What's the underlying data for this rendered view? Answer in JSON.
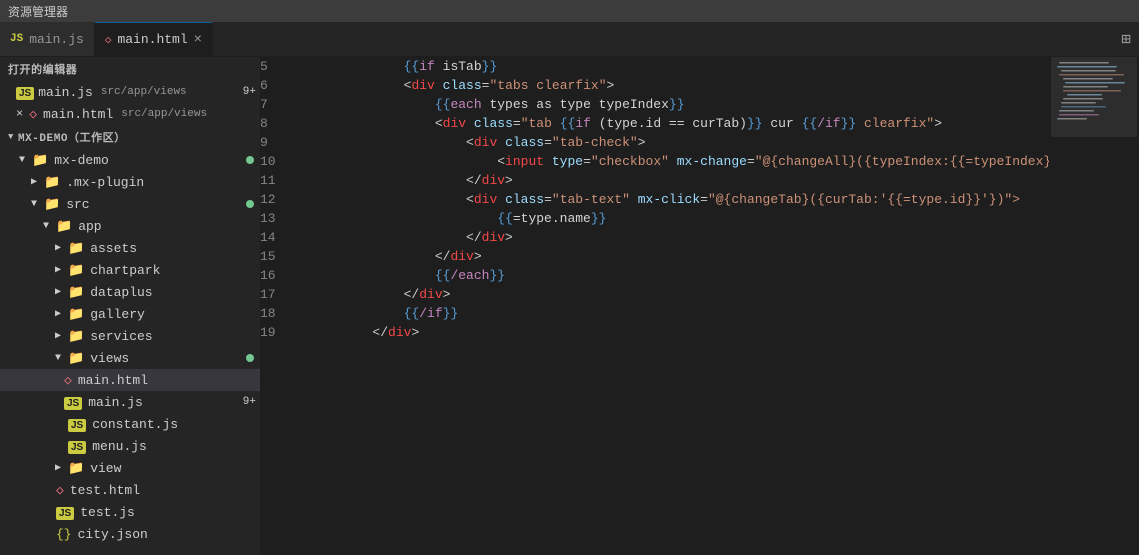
{
  "titleBar": {
    "label": "资源管理器"
  },
  "tabs": [
    {
      "id": "main-js",
      "type": "js",
      "label": "main.js",
      "path": "src/app/views",
      "badge": "9+",
      "active": false,
      "modified": false
    },
    {
      "id": "main-html",
      "type": "html",
      "label": "main.html",
      "path": "src/app/views",
      "active": true,
      "modified": true
    }
  ],
  "sidebar": {
    "openedEditors": "打开的编辑器",
    "workspaceName": "MX-DEMO（工作区）",
    "openedFiles": [
      {
        "type": "js",
        "name": "main.js",
        "path": "src/app/views",
        "badge": "9+"
      },
      {
        "type": "html",
        "name": "main.html",
        "path": "src/app/views",
        "modified": true
      }
    ],
    "tree": [
      {
        "id": "mx-demo",
        "level": 0,
        "type": "folder-open",
        "label": "mx-demo",
        "hasDot": true
      },
      {
        "id": "mx-plugin",
        "level": 1,
        "type": "folder-closed",
        "label": ".mx-plugin"
      },
      {
        "id": "src",
        "level": 1,
        "type": "folder-open",
        "label": "src",
        "hasDot": true
      },
      {
        "id": "app",
        "level": 2,
        "type": "folder-open",
        "label": "app"
      },
      {
        "id": "assets",
        "level": 3,
        "type": "folder-closed",
        "label": "assets"
      },
      {
        "id": "chartpark",
        "level": 3,
        "type": "folder-closed",
        "label": "chartpark"
      },
      {
        "id": "dataplus",
        "level": 3,
        "type": "folder-closed",
        "label": "dataplus"
      },
      {
        "id": "gallery",
        "level": 3,
        "type": "folder-closed",
        "label": "gallery"
      },
      {
        "id": "services",
        "level": 3,
        "type": "folder-closed",
        "label": "services"
      },
      {
        "id": "views",
        "level": 3,
        "type": "folder-open",
        "label": "views",
        "hasDot": true
      },
      {
        "id": "main-html-tree",
        "level": 4,
        "type": "html",
        "label": "main.html",
        "active": true
      },
      {
        "id": "main-js-tree",
        "level": 4,
        "type": "js",
        "label": "main.js",
        "badge": "9+"
      },
      {
        "id": "constant-js",
        "level": 3,
        "type": "js",
        "label": "constant.js"
      },
      {
        "id": "menu-js",
        "level": 3,
        "type": "js",
        "label": "menu.js"
      },
      {
        "id": "view",
        "level": 3,
        "type": "folder-closed",
        "label": "view"
      },
      {
        "id": "test-html",
        "level": 2,
        "type": "html",
        "label": "test.html"
      },
      {
        "id": "test-js",
        "level": 2,
        "type": "js",
        "label": "test.js"
      },
      {
        "id": "city-json",
        "level": 2,
        "type": "json",
        "label": "city.json"
      }
    ]
  },
  "editor": {
    "lines": [
      {
        "num": 5,
        "tokens": [
          {
            "t": "t-plain",
            "v": "            "
          },
          {
            "t": "t-tmpl-brace",
            "v": "{{"
          },
          {
            "t": "t-kw",
            "v": "if"
          },
          {
            "t": "t-plain",
            "v": " isTab"
          },
          {
            "t": "t-tmpl-brace",
            "v": "}}"
          }
        ]
      },
      {
        "num": 6,
        "tokens": [
          {
            "t": "t-plain",
            "v": "            "
          },
          {
            "t": "t-punct",
            "v": "<"
          },
          {
            "t": "t-tag",
            "v": "div"
          },
          {
            "t": "t-plain",
            "v": " "
          },
          {
            "t": "t-attr",
            "v": "class"
          },
          {
            "t": "t-punct",
            "v": "="
          },
          {
            "t": "t-str",
            "v": "\"tabs clearfix\""
          },
          {
            "t": "t-punct",
            "v": ">"
          }
        ]
      },
      {
        "num": 7,
        "tokens": [
          {
            "t": "t-plain",
            "v": "                "
          },
          {
            "t": "t-tmpl-brace",
            "v": "{{"
          },
          {
            "t": "t-kw",
            "v": "each"
          },
          {
            "t": "t-plain",
            "v": " types as type typeIndex"
          },
          {
            "t": "t-tmpl-brace",
            "v": "}}"
          }
        ]
      },
      {
        "num": 8,
        "tokens": [
          {
            "t": "t-plain",
            "v": "                "
          },
          {
            "t": "t-punct",
            "v": "<"
          },
          {
            "t": "t-tag",
            "v": "div"
          },
          {
            "t": "t-plain",
            "v": " "
          },
          {
            "t": "t-attr",
            "v": "class"
          },
          {
            "t": "t-punct",
            "v": "="
          },
          {
            "t": "t-str",
            "v": "\"tab "
          },
          {
            "t": "t-tmpl-brace",
            "v": "{{"
          },
          {
            "t": "t-kw",
            "v": "if"
          },
          {
            "t": "t-plain",
            "v": " (type.id == curTab)"
          },
          {
            "t": "t-tmpl-brace",
            "v": "}}"
          },
          {
            "t": "t-plain",
            "v": " cur "
          },
          {
            "t": "t-tmpl-brace",
            "v": "{{"
          },
          {
            "t": "t-kw",
            "v": "/if"
          },
          {
            "t": "t-tmpl-brace",
            "v": "}}"
          },
          {
            "t": "t-str",
            "v": " clearfix\""
          },
          {
            "t": "t-punct",
            "v": ">"
          }
        ]
      },
      {
        "num": 9,
        "tokens": [
          {
            "t": "t-plain",
            "v": "                    "
          },
          {
            "t": "t-punct",
            "v": "<"
          },
          {
            "t": "t-tag",
            "v": "div"
          },
          {
            "t": "t-plain",
            "v": " "
          },
          {
            "t": "t-attr",
            "v": "class"
          },
          {
            "t": "t-punct",
            "v": "="
          },
          {
            "t": "t-str",
            "v": "\"tab-check\""
          },
          {
            "t": "t-punct",
            "v": ">"
          }
        ]
      },
      {
        "num": 10,
        "tokens": [
          {
            "t": "t-plain",
            "v": "                        "
          },
          {
            "t": "t-punct",
            "v": "<"
          },
          {
            "t": "t-tag",
            "v": "input"
          },
          {
            "t": "t-plain",
            "v": " "
          },
          {
            "t": "t-attr",
            "v": "type"
          },
          {
            "t": "t-punct",
            "v": "="
          },
          {
            "t": "t-str",
            "v": "\"checkbox\""
          },
          {
            "t": "t-plain",
            "v": " "
          },
          {
            "t": "t-attr",
            "v": "mx-change"
          },
          {
            "t": "t-punct",
            "v": "="
          },
          {
            "t": "t-str",
            "v": "\"@{changeAll}({typeIndex:{{=typeIndex}}})\"}"
          },
          {
            "t": "t-plain",
            "v": " />"
          }
        ]
      },
      {
        "num": 11,
        "tokens": [
          {
            "t": "t-plain",
            "v": "                    "
          },
          {
            "t": "t-punct",
            "v": "</"
          },
          {
            "t": "t-tag",
            "v": "div"
          },
          {
            "t": "t-punct",
            "v": ">"
          }
        ]
      },
      {
        "num": 12,
        "tokens": [
          {
            "t": "t-plain",
            "v": "                    "
          },
          {
            "t": "t-punct",
            "v": "<"
          },
          {
            "t": "t-tag",
            "v": "div"
          },
          {
            "t": "t-plain",
            "v": " "
          },
          {
            "t": "t-attr",
            "v": "class"
          },
          {
            "t": "t-punct",
            "v": "="
          },
          {
            "t": "t-str",
            "v": "\"tab-text\""
          },
          {
            "t": "t-plain",
            "v": " "
          },
          {
            "t": "t-attr",
            "v": "mx-click"
          },
          {
            "t": "t-punct",
            "v": "="
          },
          {
            "t": "t-str",
            "v": "\"@{changeTab}({curTab:'{{=type.id}}'})\">"
          }
        ]
      },
      {
        "num": 13,
        "tokens": [
          {
            "t": "t-plain",
            "v": "                        "
          },
          {
            "t": "t-tmpl-brace",
            "v": "{{"
          },
          {
            "t": "t-plain",
            "v": "=type.name"
          },
          {
            "t": "t-tmpl-brace",
            "v": "}}"
          }
        ]
      },
      {
        "num": 14,
        "tokens": [
          {
            "t": "t-plain",
            "v": "                    "
          },
          {
            "t": "t-punct",
            "v": "</"
          },
          {
            "t": "t-tag",
            "v": "div"
          },
          {
            "t": "t-punct",
            "v": ">"
          }
        ]
      },
      {
        "num": 15,
        "tokens": [
          {
            "t": "t-plain",
            "v": "                "
          },
          {
            "t": "t-punct",
            "v": "</"
          },
          {
            "t": "t-tag",
            "v": "div"
          },
          {
            "t": "t-punct",
            "v": ">"
          }
        ]
      },
      {
        "num": 16,
        "tokens": [
          {
            "t": "t-plain",
            "v": "                "
          },
          {
            "t": "t-tmpl-brace",
            "v": "{{"
          },
          {
            "t": "t-kw",
            "v": "/each"
          },
          {
            "t": "t-tmpl-brace",
            "v": "}}"
          }
        ]
      },
      {
        "num": 17,
        "tokens": [
          {
            "t": "t-plain",
            "v": "            "
          },
          {
            "t": "t-punct",
            "v": "</"
          },
          {
            "t": "t-tag",
            "v": "div"
          },
          {
            "t": "t-punct",
            "v": ">"
          }
        ]
      },
      {
        "num": 18,
        "tokens": [
          {
            "t": "t-plain",
            "v": "            "
          },
          {
            "t": "t-tmpl-brace",
            "v": "{{"
          },
          {
            "t": "t-kw",
            "v": "/if"
          },
          {
            "t": "t-tmpl-brace",
            "v": "}}"
          }
        ]
      },
      {
        "num": 19,
        "tokens": [
          {
            "t": "t-plain",
            "v": "        "
          },
          {
            "t": "t-punct",
            "v": "</"
          },
          {
            "t": "t-tag",
            "v": "div"
          },
          {
            "t": "t-punct",
            "v": ">"
          }
        ]
      }
    ]
  }
}
